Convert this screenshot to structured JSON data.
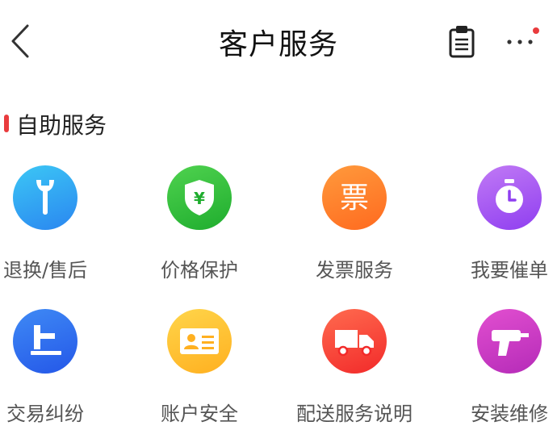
{
  "header": {
    "title": "客户服务",
    "back_icon": "chevron-left-icon",
    "clipboard_icon": "clipboard-icon",
    "more_icon": "more-dots-icon",
    "notification_dot_color": "#e93b3d"
  },
  "section": {
    "title": "自助服务",
    "accent_color": "#e93b3d"
  },
  "services": [
    {
      "label": "退换/售后",
      "icon": "wrench-icon",
      "gradient": [
        "#3cc7f5",
        "#2a86f0"
      ]
    },
    {
      "label": "价格保护",
      "icon": "shield-yuan-icon",
      "gradient": [
        "#4fd24f",
        "#1fad2e"
      ]
    },
    {
      "label": "发票服务",
      "icon": "invoice-icon",
      "icon_text": "票",
      "gradient": [
        "#ff9a3c",
        "#ff6a1f"
      ]
    },
    {
      "label": "我要催单",
      "icon": "stopwatch-icon",
      "gradient": [
        "#c17af5",
        "#8f3ef0"
      ]
    },
    {
      "label": "交易纠纷",
      "icon": "gavel-icon",
      "gradient": [
        "#3f8af5",
        "#2457e8"
      ]
    },
    {
      "label": "账户安全",
      "icon": "id-card-icon",
      "gradient": [
        "#ffd54a",
        "#ffb020"
      ]
    },
    {
      "label": "配送服务说明",
      "icon": "truck-icon",
      "gradient": [
        "#ff6b4f",
        "#f22a2a"
      ]
    },
    {
      "label": "安装维修",
      "icon": "drill-icon",
      "gradient": [
        "#e24fd0",
        "#b52bb8"
      ]
    }
  ]
}
